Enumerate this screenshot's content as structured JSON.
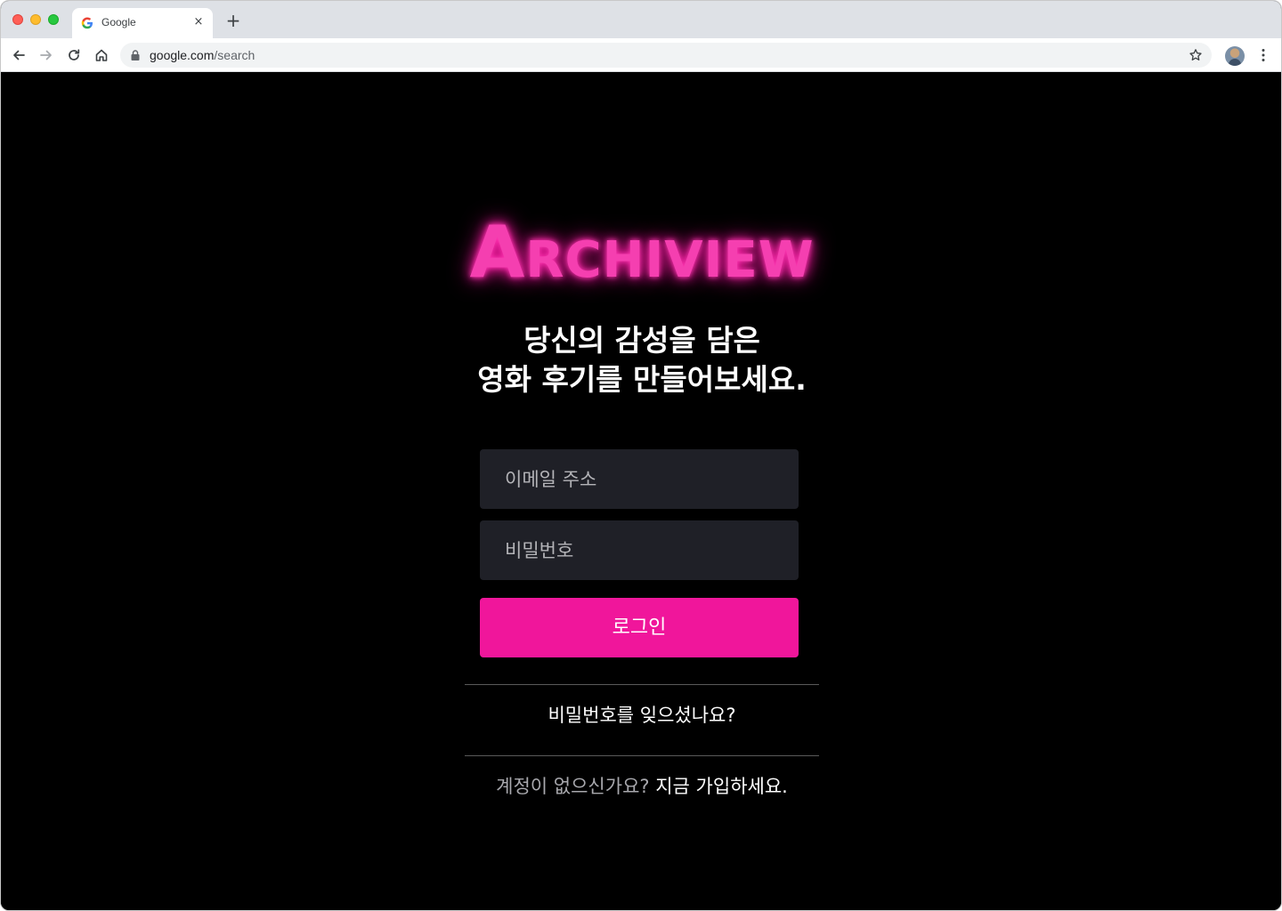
{
  "browser": {
    "tab_title": "Google",
    "tab_close": "×",
    "new_tab": "+",
    "url_host": "google.com",
    "url_path": "/search"
  },
  "page": {
    "logo_text": "Archiview",
    "tagline_line1": "당신의 감성을 담은",
    "tagline_line2": "영화 후기를 만들어보세요.",
    "email_placeholder": "이메일 주소",
    "password_placeholder": "비밀번호",
    "login_button": "로그인",
    "forgot_password": "비밀번호를 잊으셨나요?",
    "signup_prompt": "계정이 없으신가요?",
    "signup_link": "지금 가입하세요."
  },
  "colors": {
    "accent": "#f0169b",
    "logo_glow": "#ff1aa6",
    "input_background": "#1f2027",
    "page_background": "#000000"
  }
}
